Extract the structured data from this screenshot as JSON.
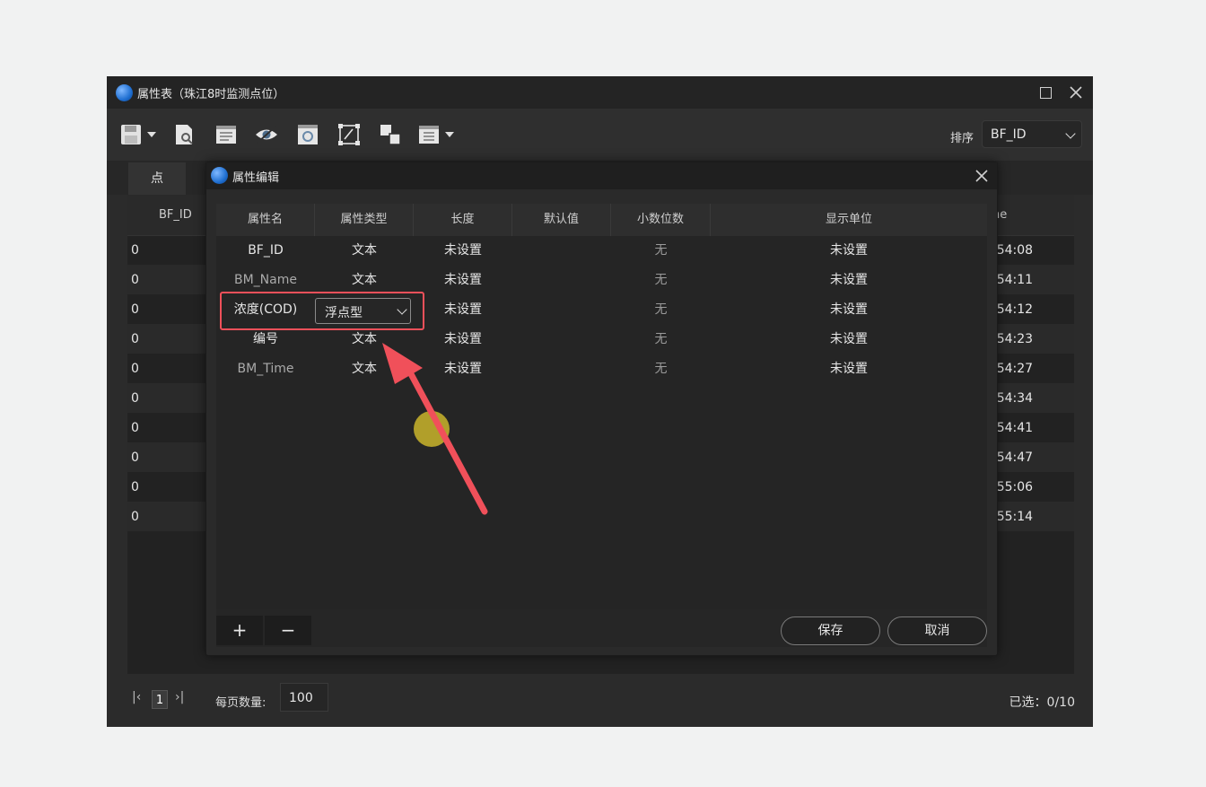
{
  "window": {
    "title": "属性表（珠江8时监测点位）"
  },
  "toolbar": {
    "icons": [
      "save-icon",
      "find-icon",
      "list-icon",
      "eye-icon",
      "table-icon",
      "edit-shape-icon",
      "swap-icon",
      "layout-icon"
    ],
    "sort_label": "排序",
    "sort_value": "BF_ID"
  },
  "tabs": [
    {
      "label": "点"
    }
  ],
  "grid": {
    "columns": [
      "BF_ID",
      "ne"
    ],
    "rows": [
      {
        "id": "0",
        "time": ":54:08"
      },
      {
        "id": "0",
        "time": ":54:11"
      },
      {
        "id": "0",
        "time": ":54:12"
      },
      {
        "id": "0",
        "time": ":54:23"
      },
      {
        "id": "0",
        "time": ":54:27"
      },
      {
        "id": "0",
        "time": ":54:34"
      },
      {
        "id": "0",
        "time": ":54:41"
      },
      {
        "id": "0",
        "time": ":54:47"
      },
      {
        "id": "0",
        "time": ":55:06"
      },
      {
        "id": "0",
        "time": ":55:14"
      }
    ]
  },
  "footer": {
    "page": "1",
    "per_page_label": "每页数量:",
    "per_page_value": "100",
    "selected": "已选：0/10"
  },
  "dialog": {
    "title": "属性编辑",
    "columns": [
      "属性名",
      "属性类型",
      "长度",
      "默认值",
      "小数位数",
      "显示单位"
    ],
    "rows": [
      {
        "name": "BF_ID",
        "type": "文本",
        "length": "未设置",
        "default": "",
        "decimals": "无",
        "unit": "未设置"
      },
      {
        "name": "BM_Name",
        "type": "文本",
        "length": "未设置",
        "default": "",
        "decimals": "无",
        "unit": "未设置"
      },
      {
        "name": "浓度(COD)",
        "type": "浮点型",
        "length": "未设置",
        "default": "",
        "decimals": "无",
        "unit": "未设置"
      },
      {
        "name": "编号",
        "type": "文本",
        "length": "未设置",
        "default": "",
        "decimals": "无",
        "unit": "未设置"
      },
      {
        "name": "BM_Time",
        "type": "文本",
        "length": "未设置",
        "default": "",
        "decimals": "无",
        "unit": "未设置"
      }
    ],
    "add_label": "+",
    "remove_label": "−",
    "save_label": "保存",
    "cancel_label": "取消"
  },
  "colors": {
    "highlight": "#f0505a",
    "annotation_arrow": "#f0505a",
    "cursor": "#b8a52a"
  }
}
